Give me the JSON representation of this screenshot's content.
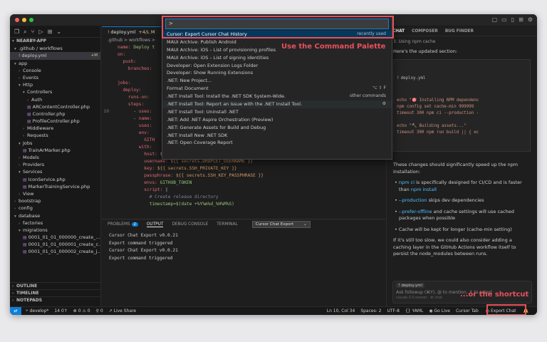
{
  "sidebar": {
    "project": "NEARBY-APP",
    "rows": [
      {
        "label": ".github / workflows",
        "indent": 1,
        "type": "folder"
      },
      {
        "label": "deploy.yml",
        "indent": 2,
        "type": "yml",
        "badge": "+M",
        "active": true
      },
      {
        "label": "app",
        "indent": 1,
        "type": "folder"
      },
      {
        "label": "Console",
        "indent": 2,
        "type": "folder-closed"
      },
      {
        "label": "Events",
        "indent": 2,
        "type": "folder-closed"
      },
      {
        "label": "Http",
        "indent": 2,
        "type": "folder"
      },
      {
        "label": "Controllers",
        "indent": 3,
        "type": "folder"
      },
      {
        "label": "Auth",
        "indent": 4,
        "type": "folder-closed"
      },
      {
        "label": "ARContentController.php",
        "indent": 4,
        "type": "php"
      },
      {
        "label": "Controller.php",
        "indent": 4,
        "type": "php"
      },
      {
        "label": "ProfileController.php",
        "indent": 4,
        "type": "php"
      },
      {
        "label": "Middleware",
        "indent": 3,
        "type": "folder-closed"
      },
      {
        "label": "Requests",
        "indent": 3,
        "type": "folder-closed"
      },
      {
        "label": "Jobs",
        "indent": 2,
        "type": "folder"
      },
      {
        "label": "TrainArMarker.php",
        "indent": 3,
        "type": "php"
      },
      {
        "label": "Models",
        "indent": 2,
        "type": "folder-closed"
      },
      {
        "label": "Providers",
        "indent": 2,
        "type": "folder-closed"
      },
      {
        "label": "Services",
        "indent": 2,
        "type": "folder"
      },
      {
        "label": "IconService.php",
        "indent": 3,
        "type": "php"
      },
      {
        "label": "MarkerTrainingService.php",
        "indent": 3,
        "type": "php"
      },
      {
        "label": "View",
        "indent": 2,
        "type": "folder-closed"
      },
      {
        "label": "bootstrap",
        "indent": 1,
        "type": "folder-closed"
      },
      {
        "label": "config",
        "indent": 1,
        "type": "folder-closed"
      },
      {
        "label": "database",
        "indent": 1,
        "type": "folder"
      },
      {
        "label": "factories",
        "indent": 2,
        "type": "folder-closed"
      },
      {
        "label": "migrations",
        "indent": 2,
        "type": "folder"
      },
      {
        "label": "0001_01_01_000000_create_...",
        "indent": 3,
        "type": "php"
      },
      {
        "label": "0001_01_01_000001_create_c...",
        "indent": 3,
        "type": "php"
      },
      {
        "label": "0001_01_01_000002_create_j...",
        "indent": 3,
        "type": "php"
      }
    ],
    "sections": [
      "OUTLINE",
      "TIMELINE",
      "NOTEPADS"
    ]
  },
  "editor": {
    "tab_label": "deploy.yml",
    "tab_status": "+4/L M",
    "breadcrumb": ".github > workflows > ",
    "lines": [
      {
        "n": "",
        "html": "<span class='k'>name:</span> <span class='s'>Deploy t</span>"
      },
      {
        "n": "",
        "html": "<span class='k'>on:</span>"
      },
      {
        "n": "",
        "html": "  <span class='k'>push:</span>"
      },
      {
        "n": "",
        "html": "    <span class='k'>branches:</span>"
      },
      {
        "n": "",
        "html": ""
      },
      {
        "n": "",
        "html": "<span class='k'>jobs:</span>"
      },
      {
        "n": "",
        "html": "  <span class='k'>deploy:</span>"
      },
      {
        "n": "",
        "html": "    <span class='k'>runs-on:</span>"
      },
      {
        "n": "",
        "html": "    <span class='k'>steps:</span>"
      },
      {
        "n": "10",
        "html": "      <span class='p'>- </span><span class='k'>uses:</span>"
      },
      {
        "n": "",
        "html": "      <span class='p'>- </span><span class='k'>name:</span>"
      },
      {
        "n": "",
        "html": "        <span class='k'>uses:</span>"
      },
      {
        "n": "",
        "html": "        <span class='k'>env:</span>"
      },
      {
        "n": "",
        "html": "          <span class='k'>GITH</span>"
      },
      {
        "n": "",
        "html": "        <span class='k'>with:</span>"
      },
      {
        "n": "",
        "html": "          <span class='k'>host:</span> <span class='v'>${{ secrets.DROPLET_IP }}</span>"
      },
      {
        "n": "",
        "html": "          <span class='k'>username:</span> <span class='v'>${{ secrets.DROPLET_USERNAME }}</span>"
      },
      {
        "n": "",
        "html": "          <span class='k'>key:</span> <span class='v'>${{ secrets.SSH_PRIVATE_KEY }}</span>"
      },
      {
        "n": "",
        "html": "          <span class='k'>passphrase:</span> <span class='v'>${{ secrets.SSH_KEY_PASSPHRASE }}</span>"
      },
      {
        "n": "",
        "html": "          <span class='k'>envs:</span> <span class='s'>GITHUB_TOKEN</span>"
      },
      {
        "n": "",
        "html": "          <span class='k'>script:</span> <span class='p'>|</span>"
      },
      {
        "n": "",
        "html": "            <span class='c'># Create release directory</span>"
      },
      {
        "n": "",
        "html": "            <span class='s'>timestamp=$(date +%Y%m%d_%H%M%S)</span>"
      }
    ]
  },
  "palette": {
    "input_value": ">",
    "items": [
      {
        "label": "Cursor: Export Cursor Chat History",
        "right": "recently used",
        "selected": true
      },
      {
        "label": "MAUI Archive: Publish Android",
        "right": ""
      },
      {
        "label": "MAUI Archive: iOS – List of provisioning profiles",
        "right": ""
      },
      {
        "label": "MAUI Archive: iOS – List of signing identities",
        "right": ""
      },
      {
        "label": "Developer: Open Extension Logs Folder",
        "right": ""
      },
      {
        "label": "Developer: Show Running Extensions",
        "right": ""
      },
      {
        "label": ".NET: New Project...",
        "right": ""
      },
      {
        "label": "Format Document",
        "right": "⌥ ⇧ F"
      },
      {
        "label": ".NET Install Tool: Install the .NET SDK System-Wide.",
        "right": "other commands"
      },
      {
        "label": ".NET Install Tool: Report an issue with the .NET Install Tool.",
        "right": "⚙",
        "hover": true
      },
      {
        "label": ".NET Install Tool: Uninstall .NET",
        "right": ""
      },
      {
        "label": ".NET: Add .NET Aspire Orchestration (Preview)",
        "right": ""
      },
      {
        "label": ".NET: Generate Assets for Build and Debug",
        "right": ""
      },
      {
        "label": ".NET Install New .NET SDK",
        "right": ""
      },
      {
        "label": ".NET: Open Coverage Report",
        "right": ""
      }
    ]
  },
  "annotations": {
    "palette_note": "Use the Command Palette",
    "shortcut_note": "...or the shortcut"
  },
  "panel": {
    "tabs": [
      "PROBLEMS",
      "OUTPUT",
      "DEBUG CONSOLE",
      "TERMINAL"
    ],
    "problems_count": "2",
    "output_channel": "Cursor Chat Export",
    "lines": [
      "Cursor Chat Export v0.0.21",
      "Export command triggered",
      "Cursor Chat Export v0.0.21",
      "Export command triggered"
    ]
  },
  "chat": {
    "tabs": [
      "CHAT",
      "COMPOSER",
      "BUG FINDER"
    ],
    "intro_top": "3. Using npm cache",
    "intro": "Here's the updated section:",
    "code_file": "deploy.yml",
    "code_lines": [
      "echo \"🎯 Installing NPM dependenc",
      "npm config set cache-min 999999",
      "timeout 300 npm ci --production -",
      "",
      "echo \"🔨 Building assets...\"",
      "timeout 300 npm run build || { ec"
    ],
    "summary": "These changes should significantly speed up the npm installation:",
    "bullets": [
      {
        "code": "npm ci",
        "text": " is specifically designed for CI/CD and is faster than ",
        "code2": "npm install"
      },
      {
        "code": "--production",
        "text": " skips dev dependencies",
        "code2": ""
      },
      {
        "code": "--prefer-offline",
        "text": " and cache settings will use cached packages when possible",
        "code2": ""
      },
      {
        "code": "",
        "text": "Cache will be kept for longer (cache-min setting)",
        "code2": ""
      }
    ],
    "closing": "If it's still too slow, we could also consider adding a caching layer in the GitHub Actions workflow itself to persist the node_modules between runs.",
    "followup_chip": "deploy.yml",
    "followup_placeholder": "Ask followup (⌘Y), @ to mention, ↑ to select",
    "followup_meta": "claude-3.5-sonnet  ·  ⌘ chat"
  },
  "status": {
    "branch": "develop*",
    "sync": "14 0↑",
    "problems": "⊗ 0 ⚠ 0",
    "ports": "⚲ 0",
    "live_share": "Live Share",
    "position": "Ln 10, Col 34",
    "spaces": "Spaces: 2",
    "encoding": "UTF-8",
    "language": "YAML",
    "go_live": "Go Live",
    "cursor_tab": "Cursor Tab",
    "export_chat": "Export Chat"
  },
  "colors": {
    "accent": "#0e7fd6",
    "annotation": "#e8505b",
    "palette_selected": "#04395e"
  }
}
